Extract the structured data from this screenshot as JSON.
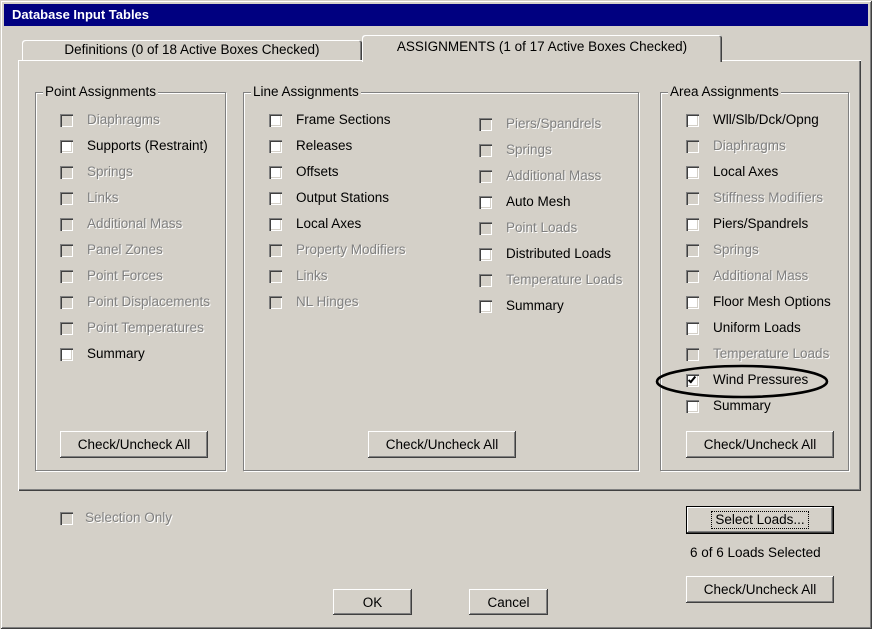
{
  "window": {
    "title": "Database Input Tables"
  },
  "tabs": [
    {
      "label": "Definitions (0 of 18 Active Boxes Checked)",
      "active": false
    },
    {
      "label": "ASSIGNMENTS (1 of 17 Active Boxes Checked)",
      "active": true
    }
  ],
  "point_assignments": {
    "title": "Point Assignments",
    "items": [
      {
        "label": "Diaphragms",
        "enabled": false,
        "checked": false
      },
      {
        "label": "Supports (Restraint)",
        "enabled": true,
        "checked": false
      },
      {
        "label": "Springs",
        "enabled": false,
        "checked": false
      },
      {
        "label": "Links",
        "enabled": false,
        "checked": false
      },
      {
        "label": "Additional Mass",
        "enabled": false,
        "checked": false
      },
      {
        "label": "Panel Zones",
        "enabled": false,
        "checked": false
      },
      {
        "label": "Point Forces",
        "enabled": false,
        "checked": false
      },
      {
        "label": "Point Displacements",
        "enabled": false,
        "checked": false
      },
      {
        "label": "Point Temperatures",
        "enabled": false,
        "checked": false
      },
      {
        "label": "Summary",
        "enabled": true,
        "checked": false
      }
    ],
    "check_all_label": "Check/Uncheck All"
  },
  "line_assignments": {
    "title": "Line Assignments",
    "columns": [
      {
        "items": [
          {
            "label": "Frame Sections",
            "enabled": true,
            "checked": false
          },
          {
            "label": "Releases",
            "enabled": true,
            "checked": false
          },
          {
            "label": "Offsets",
            "enabled": true,
            "checked": false
          },
          {
            "label": "Output Stations",
            "enabled": true,
            "checked": false
          },
          {
            "label": "Local Axes",
            "enabled": true,
            "checked": false
          },
          {
            "label": "Property Modifiers",
            "enabled": false,
            "checked": false
          },
          {
            "label": "Links",
            "enabled": false,
            "checked": false
          },
          {
            "label": "NL Hinges",
            "enabled": false,
            "checked": false
          }
        ]
      },
      {
        "items": [
          {
            "label": "Piers/Spandrels",
            "enabled": false,
            "checked": false
          },
          {
            "label": "Springs",
            "enabled": false,
            "checked": false
          },
          {
            "label": "Additional Mass",
            "enabled": false,
            "checked": false
          },
          {
            "label": "Auto Mesh",
            "enabled": true,
            "checked": false
          },
          {
            "label": "Point Loads",
            "enabled": false,
            "checked": false
          },
          {
            "label": "Distributed Loads",
            "enabled": true,
            "checked": false
          },
          {
            "label": "Temperature Loads",
            "enabled": false,
            "checked": false
          },
          {
            "label": "Summary",
            "enabled": true,
            "checked": false
          }
        ]
      }
    ],
    "check_all_label": "Check/Uncheck All"
  },
  "area_assignments": {
    "title": "Area Assignments",
    "items": [
      {
        "label": "Wll/Slb/Dck/Opng",
        "enabled": true,
        "checked": false
      },
      {
        "label": "Diaphragms",
        "enabled": false,
        "checked": false
      },
      {
        "label": "Local Axes",
        "enabled": true,
        "checked": false
      },
      {
        "label": "Stiffness Modifiers",
        "enabled": false,
        "checked": false
      },
      {
        "label": "Piers/Spandrels",
        "enabled": true,
        "checked": false
      },
      {
        "label": "Springs",
        "enabled": false,
        "checked": false
      },
      {
        "label": "Additional Mass",
        "enabled": false,
        "checked": false
      },
      {
        "label": "Floor Mesh Options",
        "enabled": true,
        "checked": false
      },
      {
        "label": "Uniform Loads",
        "enabled": true,
        "checked": false
      },
      {
        "label": "Temperature Loads",
        "enabled": false,
        "checked": false
      },
      {
        "label": "Wind Pressures",
        "enabled": true,
        "checked": true
      },
      {
        "label": "Summary",
        "enabled": true,
        "checked": false
      }
    ],
    "check_all_label": "Check/Uncheck All"
  },
  "footer": {
    "selection_only": {
      "label": "Selection Only",
      "enabled": false,
      "checked": false
    },
    "select_loads_label": "Select Loads...",
    "loads_status": "6 of 6 Loads Selected",
    "check_all_label": "Check/Uncheck All",
    "ok_label": "OK",
    "cancel_label": "Cancel"
  },
  "colors": {
    "face": "#D4D0C8",
    "title_bar": "#000080",
    "disabled_text": "#808080",
    "annotation": "#000000"
  }
}
